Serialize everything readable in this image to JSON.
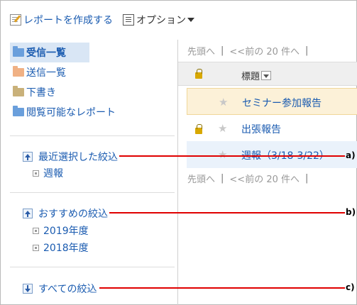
{
  "toolbar": {
    "create_label": "レポートを作成する",
    "options_label": "オプション"
  },
  "folders": [
    {
      "label": "受信一覧",
      "selected": true
    },
    {
      "label": "送信一覧",
      "selected": false
    },
    {
      "label": "下書き",
      "selected": false
    },
    {
      "label": "閲覧可能なレポート",
      "selected": false
    }
  ],
  "filters": {
    "recent": {
      "label": "最近選択した絞込",
      "items": [
        "週報"
      ]
    },
    "recommended": {
      "label": "おすすめの絞込",
      "items": [
        "2019年度",
        "2018年度"
      ]
    },
    "all": {
      "label": "すべての絞込"
    }
  },
  "callouts": [
    "a)",
    "b)",
    "c)"
  ],
  "pager": {
    "first": "先頭へ",
    "prev": "<<前の 20 件へ",
    "separator": "|"
  },
  "list": {
    "title_header": "標題",
    "rows": [
      {
        "title": "セミナー参加報告",
        "locked": false
      },
      {
        "title": "出張報告",
        "locked": true
      },
      {
        "title": "週報（3/18-3/22）",
        "locked": false
      }
    ]
  },
  "colors": {
    "link": "#1a5bb0",
    "callout": "#e00000",
    "highlight_row": "#fcf1d8",
    "selected_folder": "#d9e6f5"
  }
}
